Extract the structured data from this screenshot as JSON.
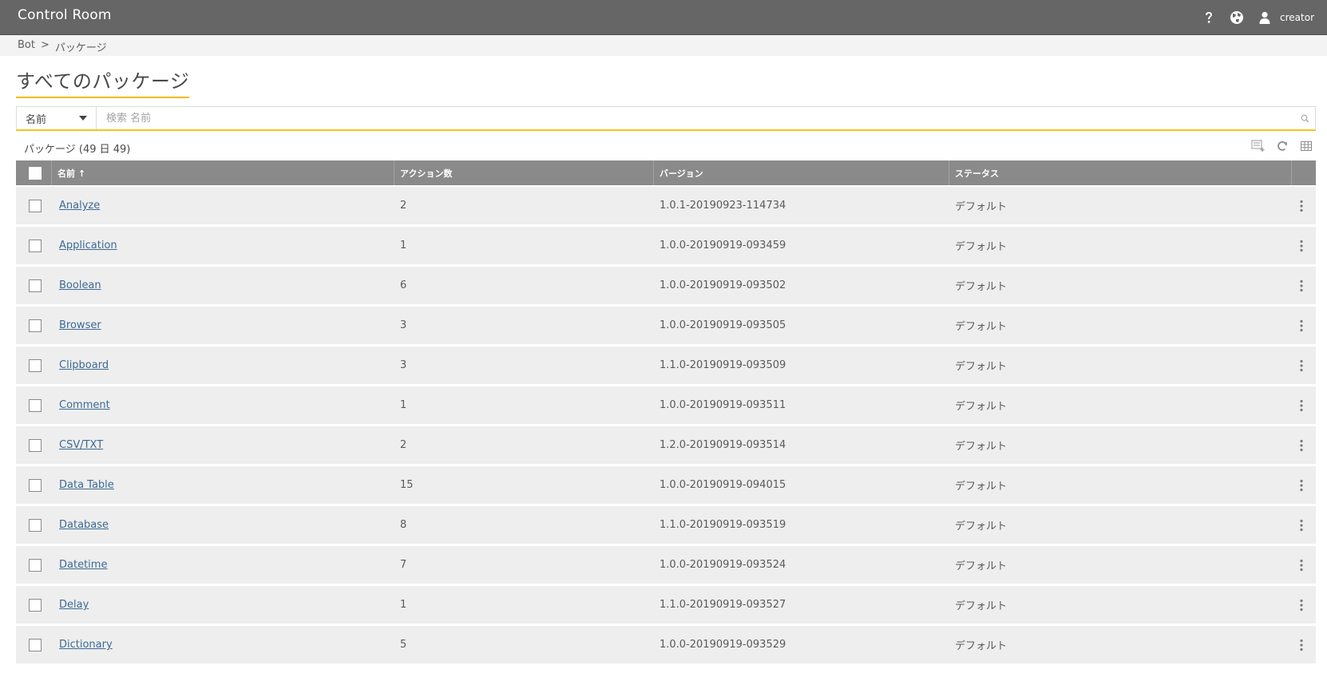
{
  "header": {
    "brand": "Control Room",
    "user": "creator",
    "icons": [
      "help-icon",
      "globe-icon",
      "user-icon"
    ]
  },
  "breadcrumb": {
    "root": "Bot",
    "separator": ">",
    "current": "パッケージ"
  },
  "page": {
    "title": "すべてのパッケージ"
  },
  "search": {
    "field": "名前",
    "placeholder": "検索 名前"
  },
  "table": {
    "count_label": "パッケージ (49 日 49)",
    "tools": [
      "export-csv-icon",
      "refresh-icon",
      "columns-icon"
    ],
    "columns": {
      "name": "名前 ↑",
      "actions": "アクション数",
      "version": "バージョン",
      "status": "ステータス"
    },
    "rows": [
      {
        "name": "Analyze",
        "actions": "2",
        "version": "1.0.1-20190923-114734",
        "status": "デフォルト"
      },
      {
        "name": "Application",
        "actions": "1",
        "version": "1.0.0-20190919-093459",
        "status": "デフォルト"
      },
      {
        "name": "Boolean",
        "actions": "6",
        "version": "1.0.0-20190919-093502",
        "status": "デフォルト"
      },
      {
        "name": "Browser",
        "actions": "3",
        "version": "1.0.0-20190919-093505",
        "status": "デフォルト"
      },
      {
        "name": "Clipboard",
        "actions": "3",
        "version": "1.1.0-20190919-093509",
        "status": "デフォルト"
      },
      {
        "name": "Comment",
        "actions": "1",
        "version": "1.0.0-20190919-093511",
        "status": "デフォルト"
      },
      {
        "name": "CSV/TXT",
        "actions": "2",
        "version": "1.2.0-20190919-093514",
        "status": "デフォルト"
      },
      {
        "name": "Data Table",
        "actions": "15",
        "version": "1.0.0-20190919-094015",
        "status": "デフォルト"
      },
      {
        "name": "Database",
        "actions": "8",
        "version": "1.1.0-20190919-093519",
        "status": "デフォルト"
      },
      {
        "name": "Datetime",
        "actions": "7",
        "version": "1.0.0-20190919-093524",
        "status": "デフォルト"
      },
      {
        "name": "Delay",
        "actions": "1",
        "version": "1.1.0-20190919-093527",
        "status": "デフォルト"
      },
      {
        "name": "Dictionary",
        "actions": "5",
        "version": "1.0.0-20190919-093529",
        "status": "デフォルト"
      }
    ]
  },
  "colors": {
    "topbar": "#666666",
    "accent": "#f5b800",
    "table_header": "#8a8a8a",
    "row_bg": "#eeeeee",
    "link": "#3d6a96"
  }
}
